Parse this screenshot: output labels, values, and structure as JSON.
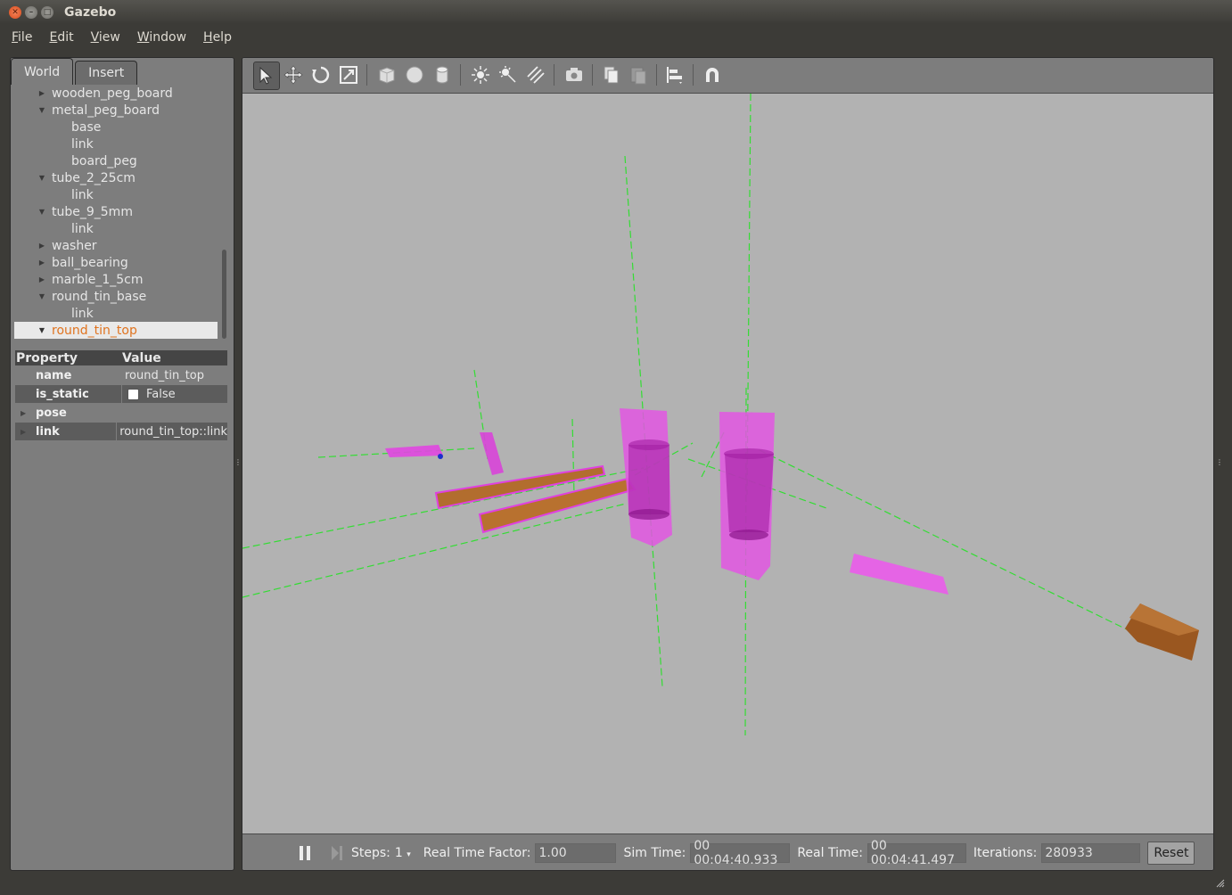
{
  "window": {
    "title": "Gazebo"
  },
  "menu": [
    "File",
    "Edit",
    "View",
    "Window",
    "Help"
  ],
  "tabs": {
    "world": "World",
    "insert": "Insert"
  },
  "tree": [
    {
      "label": "wooden_peg_board",
      "level": 1,
      "expanded": false
    },
    {
      "label": "metal_peg_board",
      "level": 1,
      "expanded": true
    },
    {
      "label": "base",
      "level": 2
    },
    {
      "label": "link",
      "level": 2
    },
    {
      "label": "board_peg",
      "level": 2
    },
    {
      "label": "tube_2_25cm",
      "level": 1,
      "expanded": true
    },
    {
      "label": "link",
      "level": 2
    },
    {
      "label": "tube_9_5mm",
      "level": 1,
      "expanded": true
    },
    {
      "label": "link",
      "level": 2
    },
    {
      "label": "washer",
      "level": 1,
      "expanded": false
    },
    {
      "label": "ball_bearing",
      "level": 1,
      "expanded": false
    },
    {
      "label": "marble_1_5cm",
      "level": 1,
      "expanded": false
    },
    {
      "label": "round_tin_base",
      "level": 1,
      "expanded": true
    },
    {
      "label": "link",
      "level": 2
    },
    {
      "label": "round_tin_top",
      "level": 1,
      "expanded": true,
      "selected": true
    }
  ],
  "properties": {
    "header": {
      "property": "Property",
      "value": "Value"
    },
    "name": {
      "label": "name",
      "value": "round_tin_top"
    },
    "is_static": {
      "label": "is_static",
      "value": "False"
    },
    "pose": {
      "label": "pose"
    },
    "link": {
      "label": "link",
      "value": "round_tin_top::link"
    }
  },
  "bottom": {
    "steps_label": "Steps:",
    "steps_value": "1",
    "rtf_label": "Real Time Factor:",
    "rtf_value": "1.00",
    "sim_label": "Sim Time:",
    "sim_value": "00 00:04:40.933",
    "real_label": "Real Time:",
    "real_value": "00 00:04:41.497",
    "iter_label": "Iterations:",
    "iter_value": "280933",
    "reset_label": "Reset"
  },
  "colors": {
    "accent_selected": "#e07420",
    "viewport_bg": "#b2b2b2",
    "magenta": "#e040e0",
    "wood": "#b06a2a",
    "axis_green": "#33dd33"
  }
}
